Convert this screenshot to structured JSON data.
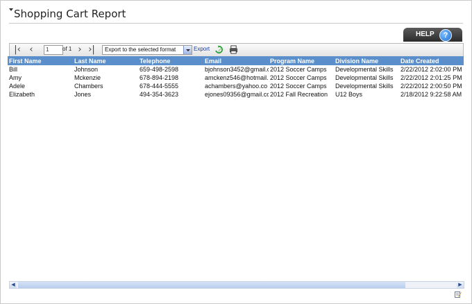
{
  "header": {
    "title": "Shopping Cart Report",
    "help_label": "HELP",
    "help_icon": "help-question-icon"
  },
  "toolbar": {
    "first_page_icon": "first-page-icon",
    "prev_page_icon": "previous-page-icon",
    "page_value": "1",
    "page_of": "of 1",
    "next_page_icon": "next-page-icon",
    "last_page_icon": "last-page-icon",
    "export_format_selected": "Export to the selected format",
    "export_label": "Export",
    "refresh_icon": "refresh-icon",
    "print_icon": "print-icon"
  },
  "table": {
    "columns": [
      "First Name",
      "Last Name",
      "Telephone",
      "Email",
      "Program Name",
      "Division Name",
      "Date Created"
    ],
    "rows": [
      [
        "Bill",
        "Johnson",
        "659-498-2598",
        "bjohnson3452@gmail.c",
        "2012 Soccer Camps",
        "Developmental Skills",
        "2/22/2012 2:02:00 PM"
      ],
      [
        "Amy",
        "Mckenzie",
        "678-894-2198",
        "amckenz546@hotmail.c",
        "2012 Soccer Camps",
        "Developmental Skills",
        "2/22/2012 2:01:25 PM"
      ],
      [
        "Adele",
        "Chambers",
        "678-444-5555",
        "achambers@yahoo.co",
        "2012 Soccer Camps",
        "Developmental Skills",
        "2/22/2012 2:00:50 PM"
      ],
      [
        "Elizabeth",
        "Jones",
        "494-354-3623",
        "ejones09356@gmail.co",
        "2012 Fall Recreation",
        "U12 Boys",
        "2/18/2012 9:22:58 AM"
      ]
    ]
  },
  "colors": {
    "header_bg": "#5b8fcc",
    "help_bg": "#3a3a3a"
  }
}
